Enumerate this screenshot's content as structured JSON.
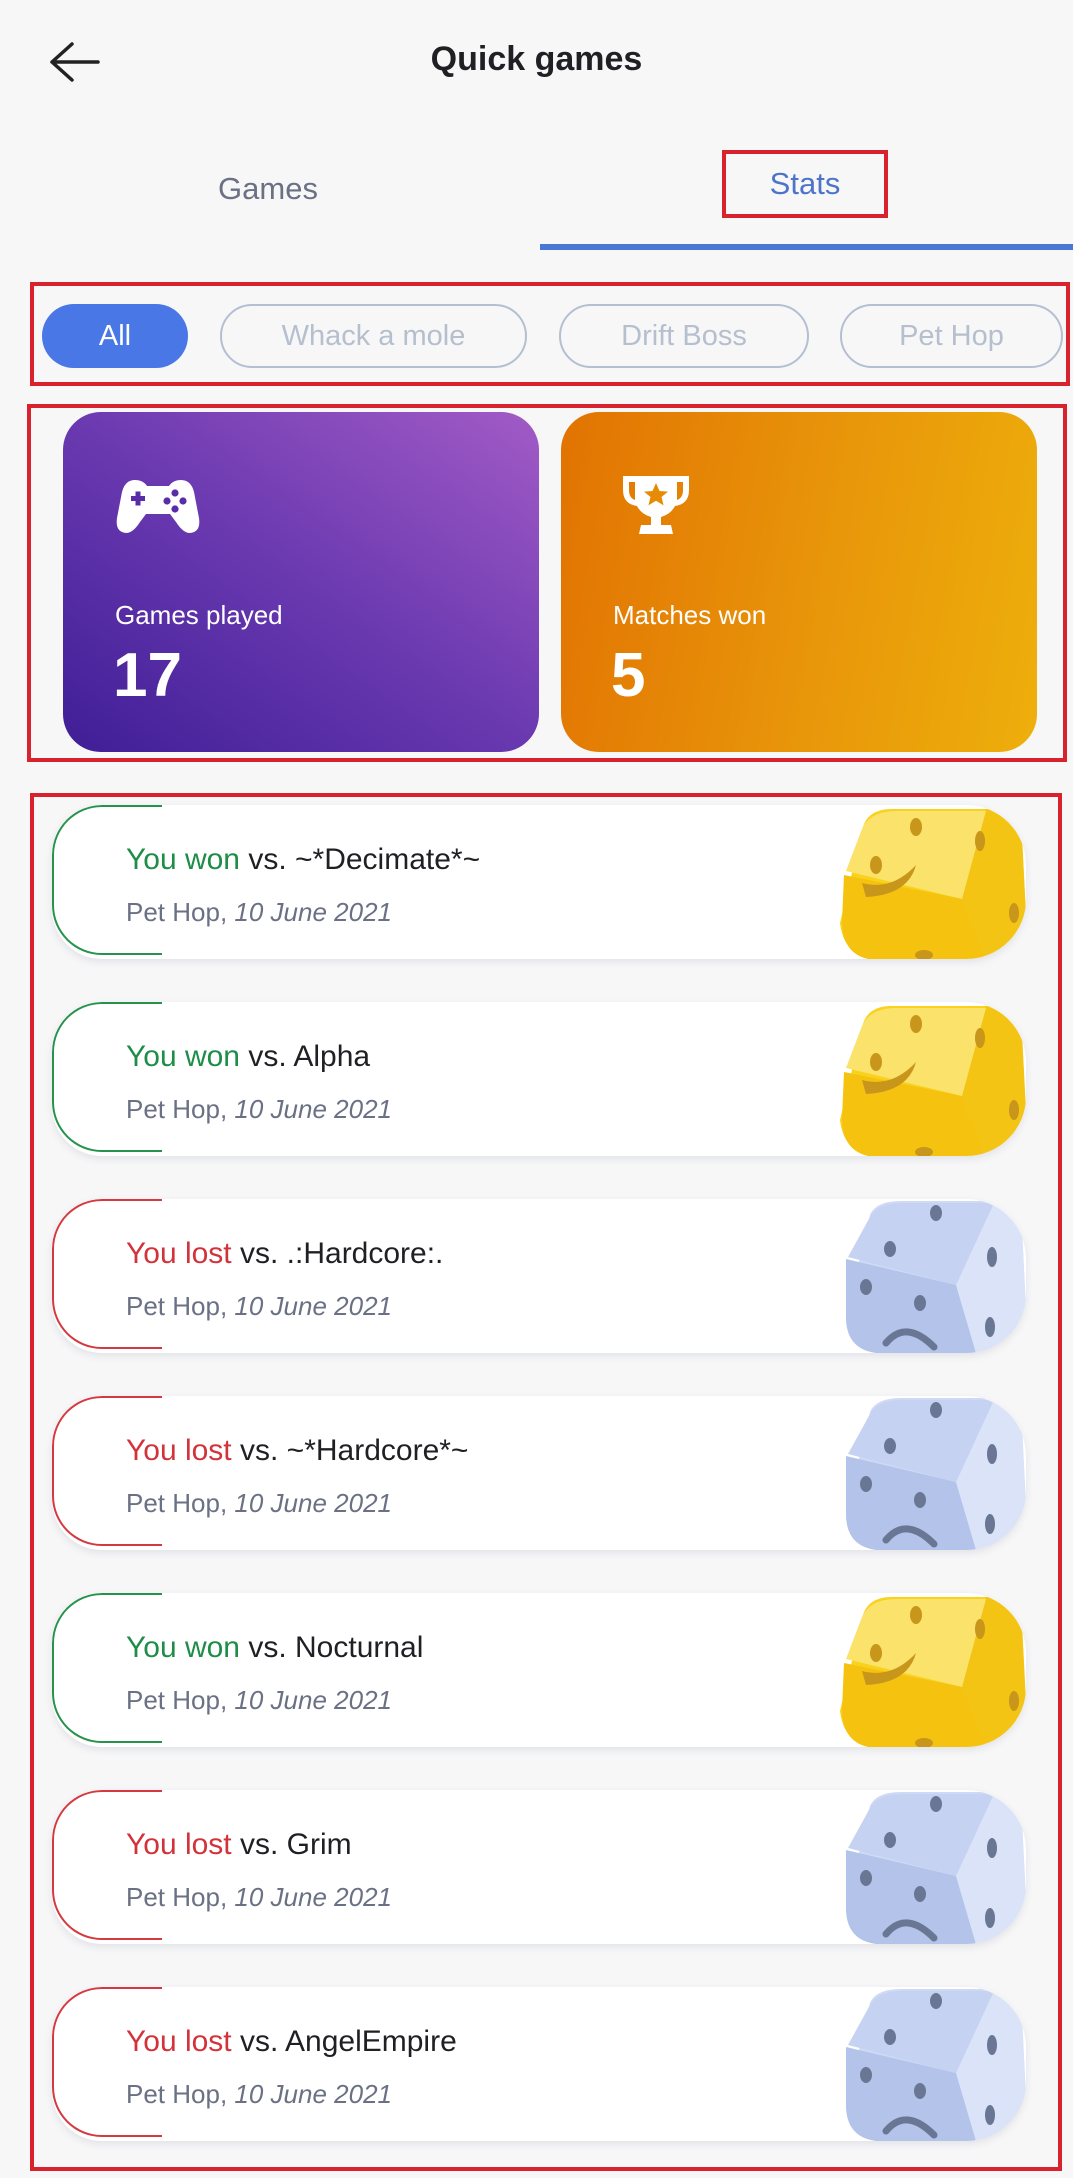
{
  "header": {
    "title": "Quick games",
    "back_icon": "arrow-left-icon"
  },
  "tabs": [
    {
      "label": "Games",
      "active": false
    },
    {
      "label": "Stats",
      "active": true
    }
  ],
  "filters": [
    {
      "label": "All",
      "active": true
    },
    {
      "label": "Whack a mole",
      "active": false
    },
    {
      "label": "Drift Boss",
      "active": false
    },
    {
      "label": "Pet Hop",
      "active": false
    }
  ],
  "stats": {
    "games_played": {
      "label": "Games played",
      "value": "17",
      "icon": "gamepad-icon"
    },
    "matches_won": {
      "label": "Matches won",
      "value": "5",
      "icon": "trophy-icon"
    }
  },
  "matches": [
    {
      "outcome": "win",
      "result": "You won",
      "vs": "vs. ~*Decimate*~",
      "game": "Pet Hop,",
      "date": "10 June 2021"
    },
    {
      "outcome": "win",
      "result": "You won",
      "vs": "vs. Alpha",
      "game": "Pet Hop,",
      "date": "10 June 2021"
    },
    {
      "outcome": "loss",
      "result": "You lost",
      "vs": "vs. .:Hardcore:.",
      "game": "Pet Hop,",
      "date": "10 June 2021"
    },
    {
      "outcome": "loss",
      "result": "You lost",
      "vs": "vs. ~*Hardcore*~",
      "game": "Pet Hop,",
      "date": "10 June 2021"
    },
    {
      "outcome": "win",
      "result": "You won",
      "vs": "vs. Nocturnal",
      "game": "Pet Hop,",
      "date": "10 June 2021"
    },
    {
      "outcome": "loss",
      "result": "You lost",
      "vs": "vs. Grim",
      "game": "Pet Hop,",
      "date": "10 June 2021"
    },
    {
      "outcome": "loss",
      "result": "You lost",
      "vs": "vs. AngelEmpire",
      "game": "Pet Hop,",
      "date": "10 June 2021"
    }
  ],
  "colors": {
    "accent": "#4a77e6",
    "win": "#1e8d47",
    "loss": "#d2323a",
    "highlight_box": "#d8222d"
  }
}
